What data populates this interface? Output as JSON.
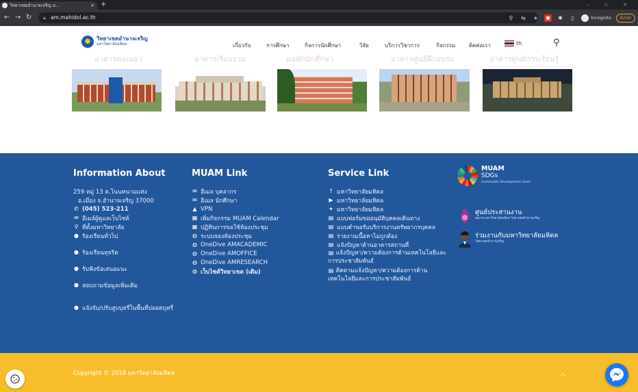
{
  "browser": {
    "tab_title": "วิทยาเขตอำนาจเจริญ ม...",
    "tab_close": "×",
    "new_tab": "+",
    "url": "am.mahidol.ac.th",
    "profile": "Incognito",
    "error_label": "Error",
    "window_controls": "–  ▫  ✕"
  },
  "header": {
    "logo_title": "วิทยาเขตอำนาจเจริญ",
    "logo_subtitle": "มหาวิทยาลัยมหิดล",
    "menu": [
      {
        "label": "เกี่ยวกับ"
      },
      {
        "label": "การศึกษา"
      },
      {
        "label": "กิจการนักศึกษา"
      },
      {
        "label": "วิจัย"
      },
      {
        "label": "บริการวิชาการ"
      },
      {
        "label": "กิจกรรม"
      },
      {
        "label": "ติดต่อเรา"
      }
    ],
    "lang": "th"
  },
  "buildings": [
    {
      "name": "อาคารดลเมธา"
    },
    {
      "name": "อาคารเรียนรวม"
    },
    {
      "name": "หอพักนักศึกษา"
    },
    {
      "name": "อาคารศูนย์ฝึกอบรม"
    },
    {
      "name": "อาคารศูนย์การเรียนรู้"
    }
  ],
  "footer": {
    "info": {
      "heading": "Information About",
      "address_line1": "259 หมู่ 13 ต.โนนหนามแท่ง",
      "address_line2": "อ.เมือง จ.อำนาจเจริญ 37000",
      "phone": "(045) 523-211",
      "links": [
        {
          "label": "อีเมล์ผู้ดูแลเว็บไซต์",
          "icon": "envelope-icon"
        },
        {
          "label": "ที่ตั้งมหาวิทยาลัย",
          "icon": "map-pin-icon"
        },
        {
          "label": "ร้องเรียนทั่วไป",
          "icon": "chat-icon"
        },
        {
          "label": "ร้องเรียนทุจริต",
          "icon": "chat-icon"
        },
        {
          "label": "รับฟังข้อเสนอแนะ",
          "icon": "chat-icon"
        },
        {
          "label": "สอบถามข้อมูลเพิ่มเติม",
          "icon": "chat-icon"
        },
        {
          "label": "แจ้งจับ/ปรับสูบบุหรี่ในพื้นที่ปลอดบุหรี่",
          "icon": "chat-icon"
        }
      ]
    },
    "muam": {
      "heading": "MUAM Link",
      "links": [
        {
          "label": "อีเมล บุคลากร",
          "icon": "envelope-icon"
        },
        {
          "label": "อีเมล นักศึกษา",
          "icon": "envelope-icon"
        },
        {
          "label": "VPN",
          "icon": "lock-icon"
        },
        {
          "label": "เพิ่มกิจกรรม MUAM Calendar",
          "icon": "calendar-icon"
        },
        {
          "label": "ปฏิทินการขอใช้ห้องประชุม",
          "icon": "calendar-icon"
        },
        {
          "label": "ระบบจองห้องประชุม",
          "icon": "globe-icon"
        },
        {
          "label": "OneDive AMACADEMIC",
          "icon": "globe-icon"
        },
        {
          "label": "OneDive AMOFFICE",
          "icon": "globe-icon"
        },
        {
          "label": "OneDive AMRESEARCH",
          "icon": "globe-icon"
        },
        {
          "label": "เว็บไซต์วิทยาเขต (เดิม)",
          "icon": "globe-icon"
        }
      ]
    },
    "service": {
      "heading": "Service Link",
      "links": [
        {
          "label": "มหาวิทยาลัยมหิดล",
          "icon": "facebook-icon"
        },
        {
          "label": "มหาวิทยาลัยมหิดล",
          "icon": "youtube-icon"
        },
        {
          "label": "มหาวิทยาลัยมหิดล",
          "icon": "twitter-icon"
        },
        {
          "label": "แบบฟอร์มขออนุมัติบุคคลเดินทาง",
          "icon": "doc-icon"
        },
        {
          "label": "แบบคำขอรับบริการงานทรัพยากรบุคคล",
          "icon": "doc-icon"
        },
        {
          "label": "รายงานเนื้อหาไม่ถูกต้อง",
          "icon": "doc-icon"
        },
        {
          "label": "แจ้งปัญหาด้านอาคารสถานที่",
          "icon": "doc-icon"
        },
        {
          "label": "แจ้งปัญหา/ความต้องการด้านเทคโนโลยีและการประชาสัมพันธ์",
          "icon": "doc-icon"
        },
        {
          "label": "ติดตามแจ้งปัญหา/ความต้องการด้านเทคโนโลยีและการประชาสัมพันธ์",
          "icon": "doc-icon"
        }
      ]
    },
    "sdg": {
      "t1": "MUAM",
      "t2": "SDGs",
      "t3": "Sustainable Development Goals"
    },
    "coordination": {
      "title": "ศูนย์ประสานงาน",
      "subtitle": "ผลงาน มหาวิทยาลัยมหิดล วิทยาเขตอำนาจเจริญ"
    },
    "work_with_us": {
      "title": "ร่วมงานกับมหาวิทยาลัยมหิดล",
      "subtitle": "วิทยาเขตอำนาจเจริญ"
    }
  },
  "bottom": {
    "copyright": "Copyright © 2018 มหาวิทยาลัยมหิดล"
  },
  "colors": {
    "footer_bg": "#22579b",
    "bottom_bg": "#f8bd2b",
    "browser_dark": "#202124"
  }
}
